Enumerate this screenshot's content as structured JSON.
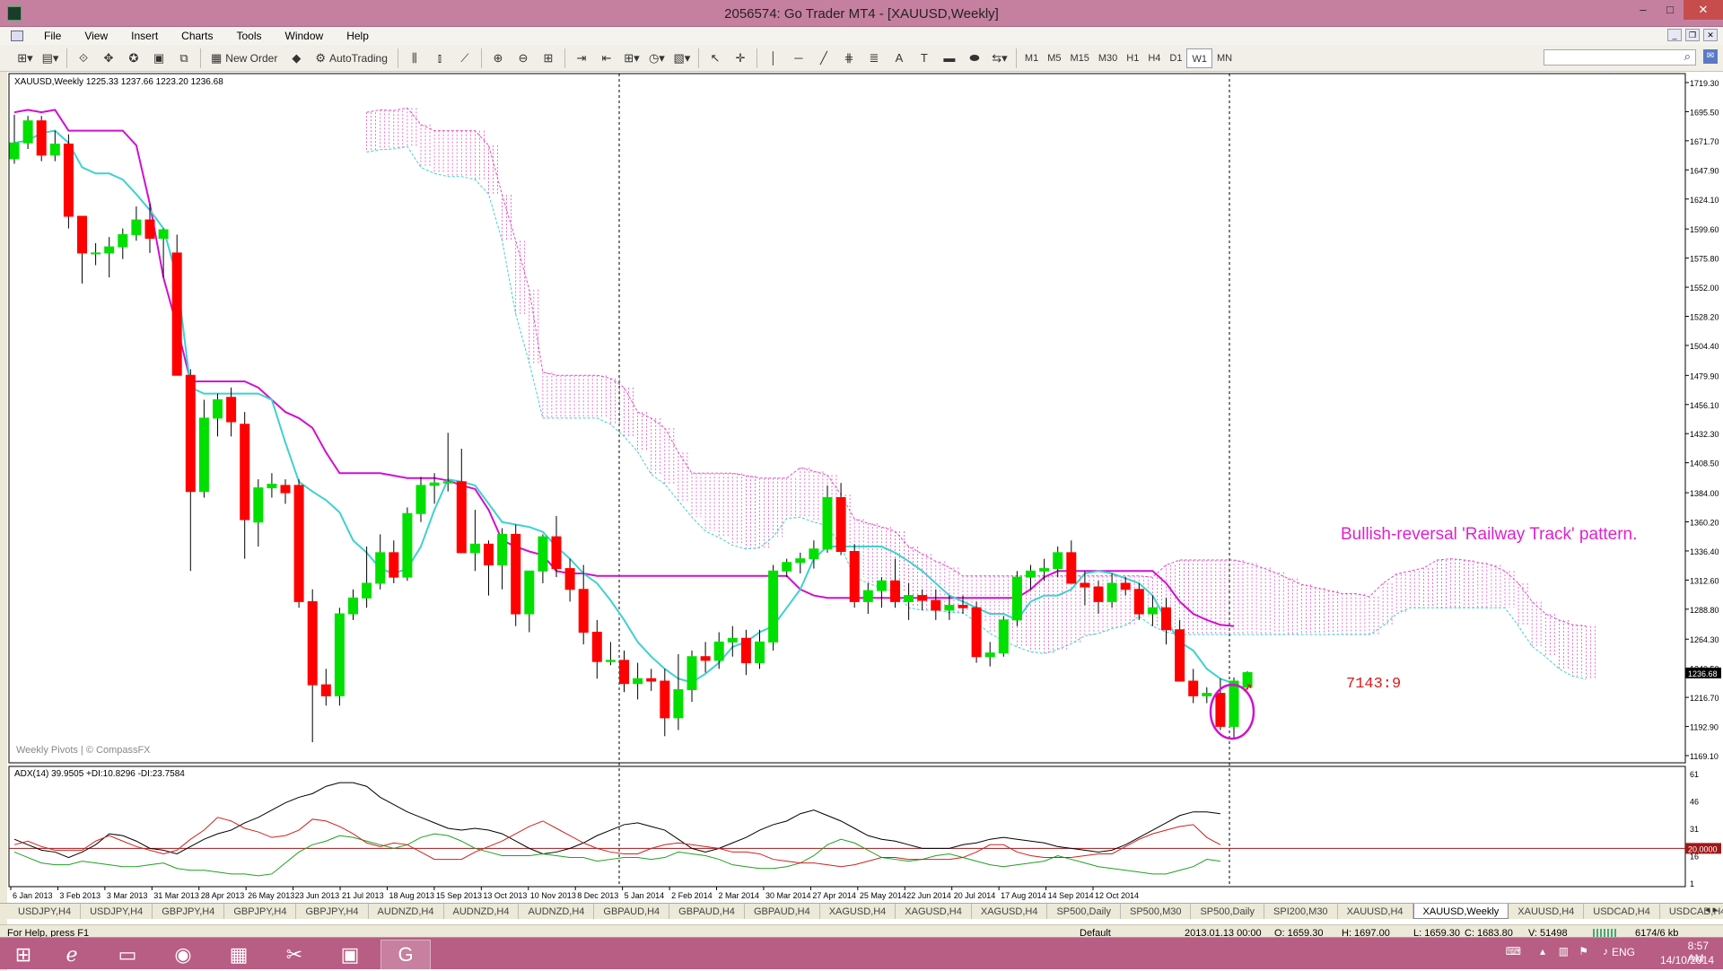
{
  "window": {
    "title": "2056574: Go Trader MT4 - [XAUUSD,Weekly]",
    "minimize": "–",
    "maximize": "□",
    "close": "✕"
  },
  "menu": [
    "File",
    "View",
    "Insert",
    "Charts",
    "Tools",
    "Window",
    "Help"
  ],
  "toolbar": {
    "new_order": "New Order",
    "autotrading": "AutoTrading",
    "timeframes": [
      "M1",
      "M5",
      "M15",
      "M30",
      "H1",
      "H4",
      "D1",
      "W1",
      "MN"
    ]
  },
  "chart": {
    "symbol_header": "XAUUSD,Weekly  1225.33 1237.66 1223.20 1236.68",
    "watermark": "Weekly Pivots | © CompassFX",
    "annotation": "Bullish-reversal 'Railway Track' pattern.",
    "ticket_label": "7143:9",
    "current_price": "1236.68",
    "adx_label": "ADX(14) 39.9505 +DI:10.8296 -DI:23.7584",
    "adx_level": "20.0000",
    "colors": {
      "up": "#00e000",
      "down": "#ff0000",
      "kijun": "#d010d0",
      "tenkan": "#40d0d0",
      "cloud": "#e050c0",
      "adx": "#000000",
      "plus_di": "#20a020",
      "minus_di": "#d02020"
    }
  },
  "chart_data": {
    "type": "candlestick",
    "price_axis": [
      "1719.30",
      "1695.50",
      "1671.70",
      "1647.90",
      "1624.10",
      "1599.60",
      "1575.80",
      "1552.00",
      "1528.20",
      "1504.40",
      "1479.90",
      "1456.10",
      "1432.30",
      "1408.50",
      "1384.00",
      "1360.20",
      "1336.40",
      "1312.60",
      "1288.80",
      "1264.30",
      "1240.50",
      "1216.70",
      "1192.90",
      "1169.10"
    ],
    "date_axis": [
      "6 Jan 2013",
      "3 Feb 2013",
      "3 Mar 2013",
      "31 Mar 2013",
      "28 Apr 2013",
      "26 May 2013",
      "23 Jun 2013",
      "21 Jul 2013",
      "18 Aug 2013",
      "15 Sep 2013",
      "13 Oct 2013",
      "10 Nov 2013",
      "8 Dec 2013",
      "5 Jan 2014",
      "2 Feb 2014",
      "2 Mar 2014",
      "30 Mar 2014",
      "27 Apr 2014",
      "25 May 2014",
      "22 Jun 2014",
      "20 Jul 2014",
      "17 Aug 2014",
      "14 Sep 2014",
      "12 Oct 2014"
    ],
    "adx_axis": [
      "61",
      "46",
      "31",
      "16",
      "1"
    ],
    "candles": [
      [
        1657,
        1693,
        1653,
        1670
      ],
      [
        1670,
        1692,
        1665,
        1688
      ],
      [
        1688,
        1692,
        1655,
        1660
      ],
      [
        1660,
        1680,
        1655,
        1669
      ],
      [
        1669,
        1677,
        1600,
        1610
      ],
      [
        1610,
        1610,
        1555,
        1580
      ],
      [
        1580,
        1588,
        1570,
        1580
      ],
      [
        1580,
        1593,
        1560,
        1585
      ],
      [
        1585,
        1600,
        1575,
        1595
      ],
      [
        1595,
        1618,
        1590,
        1607
      ],
      [
        1607,
        1620,
        1580,
        1592
      ],
      [
        1592,
        1600,
        1560,
        1599
      ],
      [
        1580,
        1595,
        1530,
        1480
      ],
      [
        1480,
        1485,
        1320,
        1385
      ],
      [
        1385,
        1460,
        1380,
        1445
      ],
      [
        1445,
        1465,
        1430,
        1460
      ],
      [
        1462,
        1470,
        1430,
        1442
      ],
      [
        1440,
        1450,
        1330,
        1362
      ],
      [
        1360,
        1395,
        1340,
        1388
      ],
      [
        1388,
        1400,
        1380,
        1391
      ],
      [
        1390,
        1395,
        1375,
        1384
      ],
      [
        1390,
        1395,
        1290,
        1295
      ],
      [
        1295,
        1305,
        1180,
        1227
      ],
      [
        1227,
        1240,
        1210,
        1218
      ],
      [
        1218,
        1290,
        1210,
        1285
      ],
      [
        1285,
        1305,
        1280,
        1298
      ],
      [
        1298,
        1340,
        1290,
        1310
      ],
      [
        1310,
        1350,
        1305,
        1335
      ],
      [
        1335,
        1345,
        1310,
        1315
      ],
      [
        1315,
        1372,
        1312,
        1367
      ],
      [
        1367,
        1397,
        1360,
        1390
      ],
      [
        1390,
        1400,
        1375,
        1392
      ],
      [
        1392,
        1433,
        1385,
        1393
      ],
      [
        1393,
        1420,
        1360,
        1335
      ],
      [
        1335,
        1370,
        1320,
        1342
      ],
      [
        1342,
        1345,
        1300,
        1325
      ],
      [
        1325,
        1355,
        1305,
        1350
      ],
      [
        1350,
        1358,
        1275,
        1285
      ],
      [
        1285,
        1300,
        1270,
        1320
      ],
      [
        1320,
        1350,
        1310,
        1348
      ],
      [
        1348,
        1365,
        1315,
        1322
      ],
      [
        1322,
        1330,
        1295,
        1305
      ],
      [
        1305,
        1325,
        1260,
        1270
      ],
      [
        1270,
        1280,
        1232,
        1246
      ],
      [
        1246,
        1262,
        1243,
        1247
      ],
      [
        1247,
        1255,
        1221,
        1228
      ],
      [
        1228,
        1245,
        1215,
        1232
      ],
      [
        1232,
        1240,
        1222,
        1230
      ],
      [
        1230,
        1240,
        1185,
        1200
      ],
      [
        1200,
        1252,
        1190,
        1223
      ],
      [
        1223,
        1255,
        1213,
        1250
      ],
      [
        1250,
        1262,
        1237,
        1247
      ],
      [
        1247,
        1270,
        1240,
        1262
      ],
      [
        1262,
        1275,
        1250,
        1265
      ],
      [
        1265,
        1272,
        1235,
        1245
      ],
      [
        1245,
        1272,
        1240,
        1262
      ],
      [
        1262,
        1325,
        1255,
        1320
      ],
      [
        1320,
        1330,
        1315,
        1327
      ],
      [
        1327,
        1335,
        1318,
        1330
      ],
      [
        1330,
        1345,
        1322,
        1338
      ],
      [
        1338,
        1390,
        1335,
        1380
      ],
      [
        1380,
        1392,
        1333,
        1336
      ],
      [
        1336,
        1342,
        1290,
        1295
      ],
      [
        1295,
        1310,
        1285,
        1304
      ],
      [
        1304,
        1315,
        1290,
        1312
      ],
      [
        1312,
        1330,
        1290,
        1295
      ],
      [
        1295,
        1310,
        1280,
        1300
      ],
      [
        1300,
        1305,
        1288,
        1296
      ],
      [
        1296,
        1305,
        1280,
        1288
      ],
      [
        1288,
        1300,
        1280,
        1292
      ],
      [
        1292,
        1300,
        1285,
        1290
      ],
      [
        1290,
        1295,
        1245,
        1250
      ],
      [
        1250,
        1262,
        1242,
        1253
      ],
      [
        1253,
        1283,
        1250,
        1280
      ],
      [
        1280,
        1320,
        1275,
        1315
      ],
      [
        1315,
        1325,
        1305,
        1320
      ],
      [
        1320,
        1330,
        1312,
        1322
      ],
      [
        1322,
        1340,
        1315,
        1335
      ],
      [
        1335,
        1345,
        1310,
        1310
      ],
      [
        1310,
        1320,
        1292,
        1307
      ],
      [
        1307,
        1312,
        1285,
        1295
      ],
      [
        1295,
        1318,
        1290,
        1310
      ],
      [
        1310,
        1315,
        1300,
        1305
      ],
      [
        1305,
        1310,
        1280,
        1285
      ],
      [
        1285,
        1300,
        1275,
        1290
      ],
      [
        1290,
        1298,
        1260,
        1272
      ],
      [
        1272,
        1280,
        1230,
        1230
      ],
      [
        1230,
        1240,
        1212,
        1218
      ],
      [
        1218,
        1225,
        1212,
        1220
      ],
      [
        1220,
        1232,
        1190,
        1193
      ],
      [
        1193,
        1233,
        1183,
        1230
      ],
      [
        1225,
        1238,
        1223,
        1237
      ]
    ],
    "kijun": [
      1695,
      1697,
      1695,
      1697,
      1680,
      1680,
      1680,
      1680,
      1680,
      1668,
      1620,
      1560,
      1520,
      1475,
      1475,
      1475,
      1475,
      1475,
      1470,
      1460,
      1450,
      1445,
      1437,
      1417,
      1400,
      1400,
      1400,
      1400,
      1398,
      1396,
      1396,
      1396,
      1394,
      1390,
      1387,
      1370,
      1345,
      1340,
      1336,
      1333,
      1320,
      1318,
      1318,
      1316,
      1316,
      1316,
      1316,
      1316,
      1316,
      1316,
      1316,
      1316,
      1316,
      1316,
      1316,
      1316,
      1316,
      1316,
      1305,
      1300,
      1298,
      1298,
      1298,
      1298,
      1298,
      1298,
      1298,
      1298,
      1298,
      1298,
      1298,
      1298,
      1298,
      1298,
      1298,
      1305,
      1315,
      1320,
      1320,
      1320,
      1320,
      1320,
      1320,
      1320,
      1320,
      1310,
      1295,
      1285,
      1280,
      1276,
      1275
    ],
    "tenkan": [
      1670,
      1672,
      1678,
      1680,
      1670,
      1650,
      1645,
      1645,
      1640,
      1628,
      1615,
      1600,
      1560,
      1470,
      1465,
      1465,
      1465,
      1465,
      1465,
      1460,
      1425,
      1393,
      1385,
      1378,
      1368,
      1345,
      1335,
      1322,
      1318,
      1322,
      1340,
      1370,
      1395,
      1393,
      1390,
      1375,
      1360,
      1358,
      1356,
      1352,
      1340,
      1330,
      1318,
      1310,
      1296,
      1280,
      1262,
      1250,
      1240,
      1232,
      1229,
      1236,
      1245,
      1258,
      1262,
      1270,
      1275,
      1290,
      1305,
      1330,
      1340,
      1340,
      1340,
      1340,
      1340,
      1335,
      1328,
      1320,
      1310,
      1300,
      1295,
      1290,
      1285,
      1285,
      1280,
      1295,
      1300,
      1300,
      1305,
      1318,
      1320,
      1318,
      1314,
      1310,
      1300,
      1280,
      1262,
      1255,
      1240,
      1232,
      1228
    ],
    "adx": [
      25,
      22,
      19,
      18,
      15,
      18,
      22,
      28,
      27,
      24,
      20,
      19,
      17,
      21,
      25,
      28,
      30,
      34,
      37,
      41,
      45,
      48,
      50,
      54,
      56,
      56,
      54,
      48,
      44,
      40,
      37,
      34,
      31,
      30,
      31,
      30,
      28,
      24,
      20,
      17,
      18,
      20,
      23,
      27,
      30,
      33,
      34,
      32,
      30,
      25,
      20,
      18,
      20,
      23,
      26,
      30,
      33,
      35,
      39,
      41,
      38,
      35,
      31,
      27,
      25,
      24,
      22,
      20,
      20,
      20,
      22,
      23,
      25,
      26,
      25,
      24,
      23,
      21,
      20,
      19,
      18,
      19,
      22,
      26,
      30,
      34,
      38,
      40,
      40,
      39
    ],
    "plus_di": [
      18,
      15,
      12,
      11,
      11,
      13,
      12,
      11,
      10,
      10,
      11,
      12,
      9,
      8,
      8,
      7,
      6,
      6,
      5,
      6,
      12,
      18,
      22,
      24,
      27,
      26,
      24,
      22,
      20,
      22,
      26,
      28,
      27,
      24,
      20,
      18,
      16,
      16,
      16,
      17,
      16,
      15,
      15,
      13,
      14,
      15,
      15,
      14,
      15,
      18,
      17,
      16,
      14,
      11,
      10,
      9,
      9,
      10,
      12,
      16,
      22,
      25,
      23,
      19,
      15,
      14,
      13,
      14,
      16,
      17,
      15,
      13,
      11,
      10,
      11,
      12,
      13,
      16,
      14,
      12,
      10,
      9,
      8,
      7,
      6,
      6,
      8,
      10,
      14,
      13
    ],
    "minus_di": [
      22,
      24,
      21,
      19,
      19,
      19,
      24,
      27,
      24,
      21,
      19,
      17,
      19,
      25,
      30,
      37,
      35,
      31,
      29,
      26,
      27,
      30,
      36,
      35,
      32,
      28,
      23,
      21,
      23,
      22,
      18,
      14,
      14,
      14,
      18,
      21,
      24,
      28,
      32,
      35,
      31,
      27,
      23,
      20,
      18,
      17,
      17,
      20,
      22,
      23,
      22,
      21,
      20,
      18,
      18,
      17,
      14,
      13,
      12,
      12,
      11,
      10,
      11,
      13,
      15,
      15,
      14,
      14,
      14,
      14,
      15,
      18,
      22,
      22,
      18,
      16,
      15,
      15,
      15,
      16,
      17,
      17,
      21,
      25,
      28,
      30,
      32,
      33,
      26,
      22
    ]
  },
  "tabs": [
    "USDJPY,H4",
    "USDJPY,H4",
    "GBPJPY,H4",
    "GBPJPY,H4",
    "GBPJPY,H4",
    "AUDNZD,H4",
    "AUDNZD,H4",
    "AUDNZD,H4",
    "GBPAUD,H4",
    "GBPAUD,H4",
    "GBPAUD,H4",
    "XAGUSD,H4",
    "XAGUSD,H4",
    "XAGUSD,H4",
    "SP500,Daily",
    "SP500,M30",
    "SP500,Daily",
    "SPI200,M30",
    "XAUUSD,H4",
    "XAUUSD,Weekly",
    "XAUUSD,H4",
    "USDCAD,H4",
    "USDCAD,H4",
    "USDC"
  ],
  "status": {
    "help": "For Help, press F1",
    "profile": "Default",
    "datetime": "2013.01.13 00:00",
    "open": "O: 1659.30",
    "high": "H: 1697.00",
    "low": "L: 1659.30",
    "close": "C: 1683.80",
    "volume": "V: 51498",
    "traffic": "6174/6 kb"
  },
  "taskbar": {
    "language": "ENG",
    "time": "8:57 AM",
    "date": "14/10/2014"
  }
}
